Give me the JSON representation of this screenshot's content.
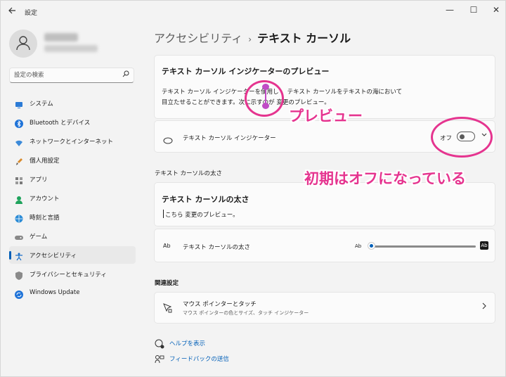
{
  "window": {
    "title": "設定",
    "back_icon": "back-arrow-icon",
    "minimize": "—",
    "maximize": "☐",
    "close": "✕"
  },
  "search": {
    "placeholder": "設定の検索",
    "icon": "search-icon"
  },
  "sidebar": {
    "items": [
      {
        "label": "システム",
        "icon": "system-icon",
        "active": false
      },
      {
        "label": "Bluetooth とデバイス",
        "icon": "bluetooth-icon",
        "active": false
      },
      {
        "label": "ネットワークとインターネット",
        "icon": "wifi-icon",
        "active": false
      },
      {
        "label": "個人用設定",
        "icon": "brush-icon",
        "active": false
      },
      {
        "label": "アプリ",
        "icon": "apps-icon",
        "active": false
      },
      {
        "label": "アカウント",
        "icon": "account-icon",
        "active": false
      },
      {
        "label": "時刻と言語",
        "icon": "globe-icon",
        "active": false
      },
      {
        "label": "ゲーム",
        "icon": "gamepad-icon",
        "active": false
      },
      {
        "label": "アクセシビリティ",
        "icon": "accessibility-icon",
        "active": true
      },
      {
        "label": "プライバシーとセキュリティ",
        "icon": "shield-icon",
        "active": false
      },
      {
        "label": "Windows Update",
        "icon": "update-icon",
        "active": false
      }
    ]
  },
  "breadcrumb": {
    "parent": "アクセシビリティ",
    "separator": "›",
    "current": "テキスト カーソル"
  },
  "preview": {
    "title": "テキスト カーソル インジケーターのプレビュー",
    "line1_a": "テキスト カーソル インジケーターを使用し",
    "line1_b": "テキスト カーソルをテキストの海において",
    "line2": "目立たせることができます。次に示すのが 変更のプレビュー。"
  },
  "indicator_setting": {
    "label": "テキスト カーソル インジケーター",
    "state_label": "オフ",
    "enabled": false
  },
  "thickness_section": {
    "header": "テキスト カーソルの太さ",
    "card_title": "テキスト カーソルの太さ",
    "preview_text": "こちら 変更のプレビュー。",
    "slider_label": "テキスト カーソルの太さ",
    "slider_icon_small": "Ab",
    "slider_icon_big": "Ab",
    "slider_value": 1
  },
  "related": {
    "header": "関連設定",
    "title": "マウス ポインターとタッチ",
    "subtitle": "マウス ポインターの色とサイズ、タッチ インジケーター"
  },
  "links": {
    "help": "ヘルプを表示",
    "feedback": "フィードバックの送信"
  },
  "annotations": {
    "preview": "プレビュー",
    "default_off": "初期はオフになっている",
    "color": "#e5348f"
  },
  "colors": {
    "accent": "#005fb8",
    "indicator": "#c04cc6"
  }
}
